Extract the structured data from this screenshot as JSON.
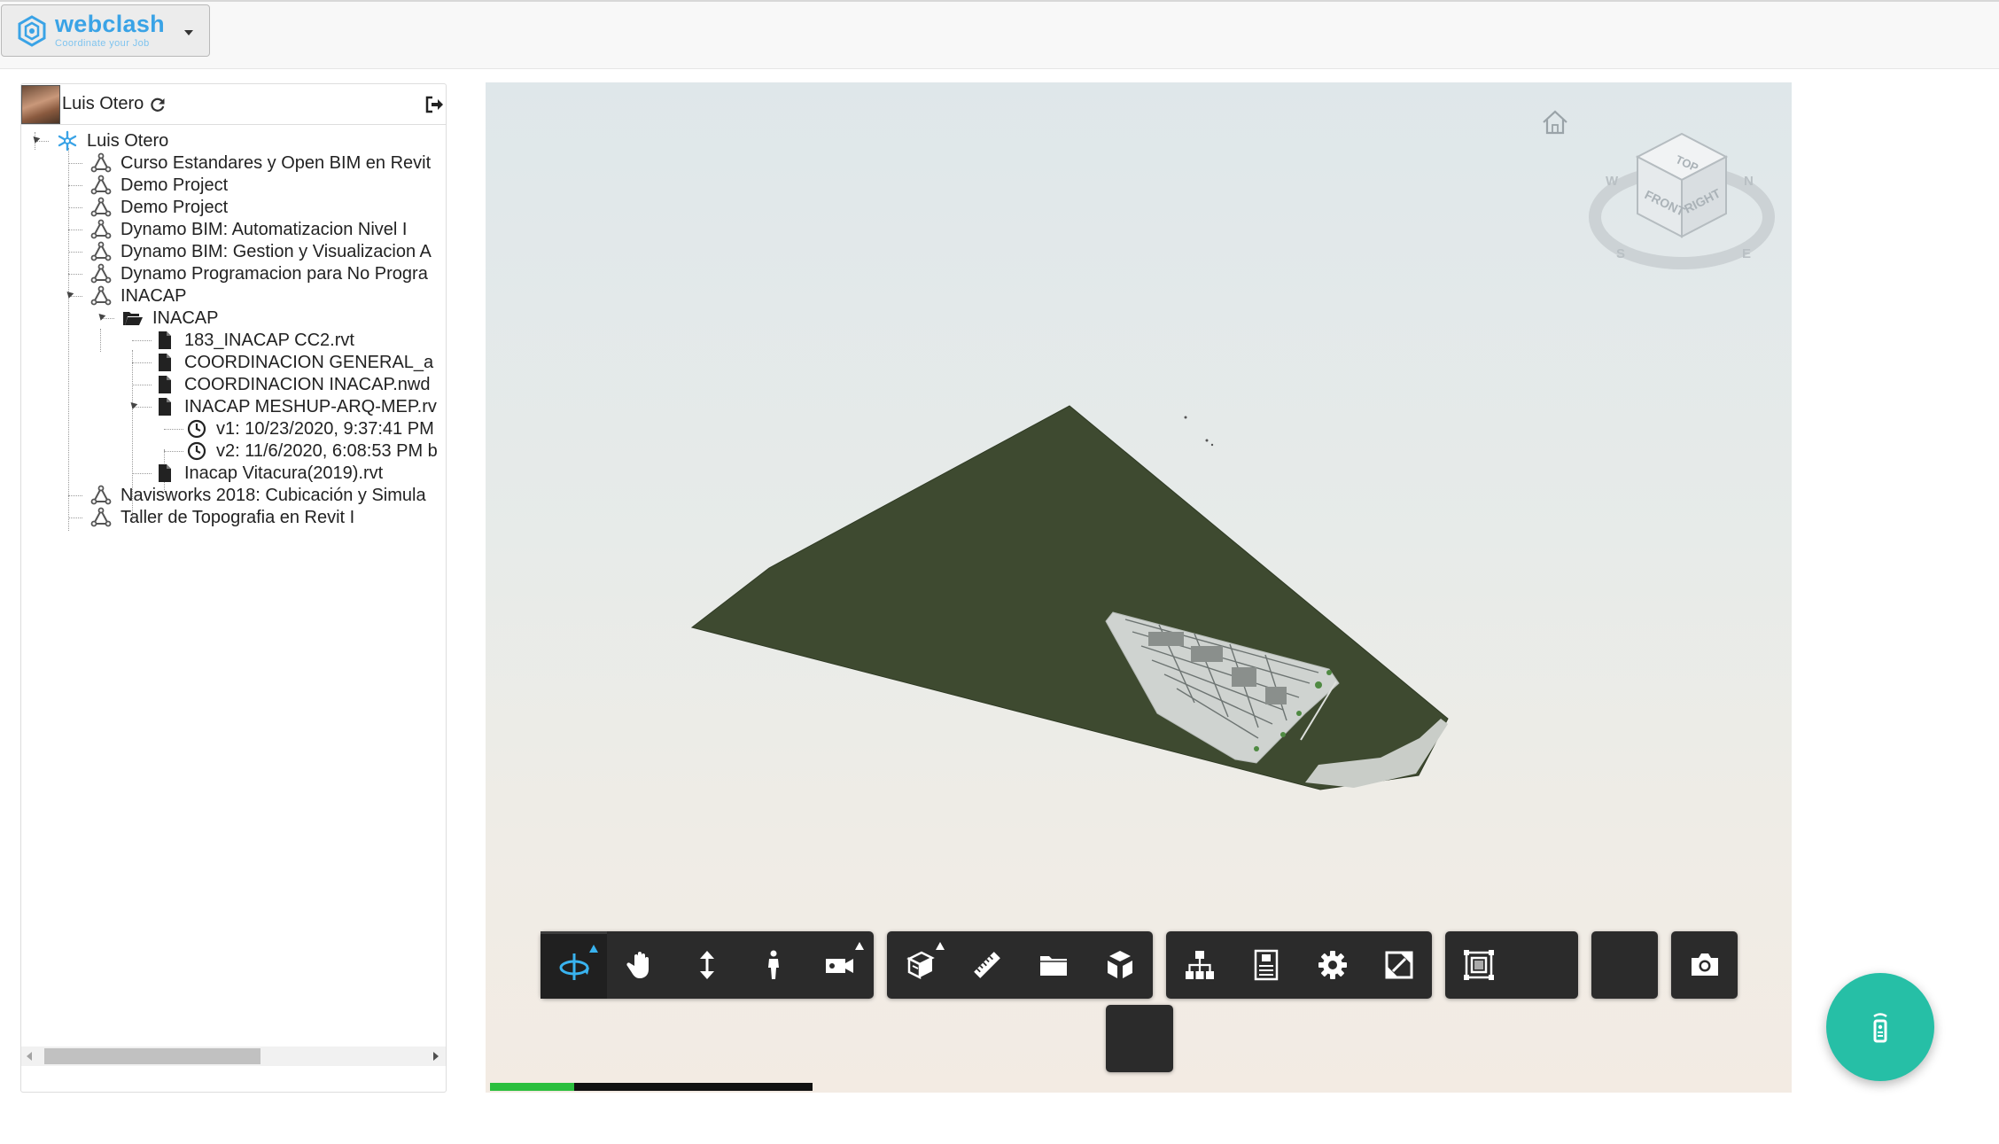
{
  "brand": {
    "name": "webclash",
    "tagline": "Coordinate your Job",
    "accent": "#3aa3e6"
  },
  "user": {
    "name": "Luis Otero",
    "refresh_icon": "refresh-icon",
    "logout_icon": "logout-icon"
  },
  "tree": {
    "root": "Luis Otero",
    "items": [
      {
        "label": "Curso Estandares y Open BIM en Revit",
        "icon": "project-icon"
      },
      {
        "label": "Demo Project",
        "icon": "project-icon"
      },
      {
        "label": "Demo Project",
        "icon": "project-icon"
      },
      {
        "label": "Dynamo BIM: Automatizacion Nivel I",
        "icon": "project-icon"
      },
      {
        "label": "Dynamo BIM: Gestion y Visualizacion A",
        "icon": "project-icon"
      },
      {
        "label": "Dynamo Programacion para No Progra",
        "icon": "project-icon"
      },
      {
        "label": "INACAP",
        "icon": "project-icon"
      },
      {
        "label": "INACAP",
        "icon": "folder-icon"
      },
      {
        "label": "183_INACAP CC2.rvt",
        "icon": "file-icon"
      },
      {
        "label": "COORDINACION GENERAL_a",
        "icon": "file-icon"
      },
      {
        "label": "COORDINACION INACAP.nwd",
        "icon": "file-icon"
      },
      {
        "label": "INACAP MESHUP-ARQ-MEP.rv",
        "icon": "file-icon"
      },
      {
        "label": "v1: 10/23/2020, 9:37:41 PM",
        "icon": "clock-icon"
      },
      {
        "label": "v2: 11/6/2020, 6:08:53 PM b",
        "icon": "clock-icon",
        "selected": true
      },
      {
        "label": "Inacap Vitacura(2019).rvt",
        "icon": "file-icon"
      },
      {
        "label": "Navisworks 2018: Cubicación y Simula",
        "icon": "project-icon"
      },
      {
        "label": "Taller de Topografia en Revit I",
        "icon": "project-icon"
      }
    ]
  },
  "viewer": {
    "viewcube_labels": {
      "top": "TOP",
      "front": "FRONT",
      "right": "RIGHT",
      "north": "N",
      "south": "S",
      "east": "E",
      "west": "W"
    },
    "toolbar": {
      "groups": [
        [
          "orbit-icon",
          "pan-icon",
          "dolly-icon",
          "first-person-icon",
          "camera-icon"
        ],
        [
          "section-icon",
          "measure-icon",
          "folder-icon",
          "explode-icon"
        ],
        [
          "model-browser-icon",
          "properties-icon",
          "settings-icon",
          "fullscreen-icon"
        ],
        [
          "fit-view-icon"
        ],
        [],
        [
          "screenshot-icon"
        ]
      ]
    },
    "progress_fraction": 0.26,
    "progress_color": "#2bbf3e"
  },
  "fab": {
    "icon": "remote-icon",
    "color": "#26bfa6"
  }
}
